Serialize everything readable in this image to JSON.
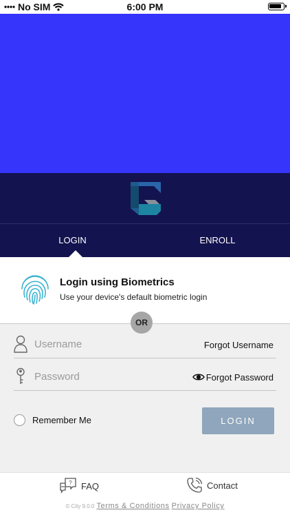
{
  "status": {
    "carrier": "No SIM",
    "time": "6:00 PM"
  },
  "colors": {
    "hero": "#3535fb",
    "band": "#13134f",
    "login_button": "#8fa6bc",
    "form_bg": "#f0f0f0",
    "fingerprint": "#3bb3cf"
  },
  "tabs": {
    "login_label": "LOGIN",
    "enroll_label": "ENROLL",
    "active": "LOGIN"
  },
  "biometric": {
    "title": "Login using Biometrics",
    "subtitle": "Use your device's default biometric login",
    "icon": "fingerprint-icon"
  },
  "separator": {
    "or_label": "OR"
  },
  "form": {
    "username": {
      "placeholder": "Username",
      "value": "",
      "forgot_label": "Forgot Username",
      "icon": "user-icon"
    },
    "password": {
      "placeholder": "Password",
      "value": "",
      "forgot_label": "Forgot Password",
      "icon": "key-icon",
      "reveal_icon": "eye-icon"
    },
    "remember_label": "Remember Me",
    "remember_checked": false,
    "login_label": "LOGIN"
  },
  "footer": {
    "faq_label": "FAQ",
    "contact_label": "Contact",
    "version": "© City 9.0.0",
    "terms_label": "Terms & Conditions",
    "privacy_label": "Privacy Policy"
  }
}
